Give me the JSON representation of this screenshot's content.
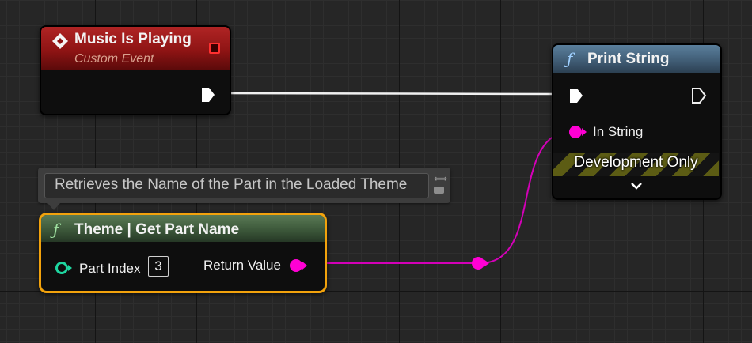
{
  "music_event": {
    "title": "Music Is Playing",
    "subtitle": "Custom Event"
  },
  "print_string": {
    "icon": "function-icon",
    "title": "Print String",
    "in_string_label": "In String",
    "dev_only_label": "Development Only"
  },
  "comment": {
    "text": "Retrieves the Name of the Part in the Loaded Theme"
  },
  "get_part_name": {
    "icon": "function-icon",
    "title": "Theme | Get Part Name",
    "part_index_label": "Part Index",
    "part_index_value": "3",
    "return_value_label": "Return Value"
  },
  "colors": {
    "event_header": "#8e1414",
    "function_header_blue": "#3f5b73",
    "function_header_green": "#3a5538",
    "string_pin": "#ff00d4",
    "int_pin": "#1ed6a0",
    "selection": "#f2a20c"
  }
}
